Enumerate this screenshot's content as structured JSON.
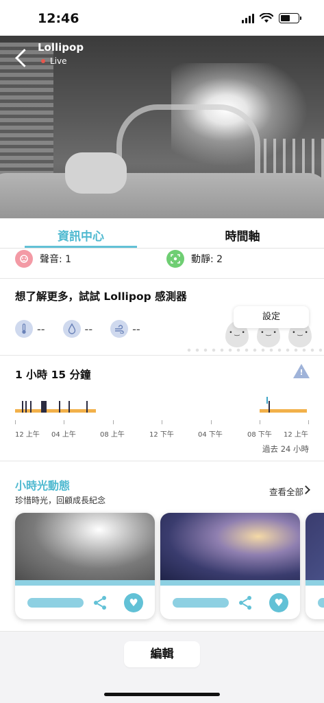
{
  "status_bar": {
    "time": "12:46"
  },
  "camera": {
    "name": "Lollipop",
    "live_label": "Live"
  },
  "tabs": [
    {
      "label": "資訊中心",
      "active": true
    },
    {
      "label": "時間軸",
      "active": false
    }
  ],
  "events": {
    "sound": {
      "label": "聲音: 1",
      "icon": "sound-icon",
      "color": "#f39aa5"
    },
    "motion": {
      "label": "動靜: 2",
      "icon": "motion-icon",
      "color": "#6fce73"
    }
  },
  "sensor": {
    "title": "想了解更多，試試 Lollipop 感測器",
    "settings_label": "設定",
    "items": [
      {
        "icon": "thermometer-icon",
        "value": "--"
      },
      {
        "icon": "humidity-drop-icon",
        "value": "--"
      },
      {
        "icon": "air-quality-icon",
        "value": "--"
      }
    ]
  },
  "timeline": {
    "duration": "1 小時 15 分鐘",
    "axis_labels": [
      "12 上午",
      "04 上午",
      "08 上午",
      "12 下午",
      "04 下午",
      "08 下午",
      "12 上午"
    ],
    "range_label": "過去 24 小時",
    "accent": "#f2b14a"
  },
  "moments": {
    "title": "小時光動態",
    "subtitle": "珍惜時光，回顧成長紀念",
    "see_all": "查看全部"
  },
  "footer": {
    "edit_label": "編輯"
  },
  "colors": {
    "accent": "#4fb9d0",
    "brand_light": "#8dd0e2"
  }
}
